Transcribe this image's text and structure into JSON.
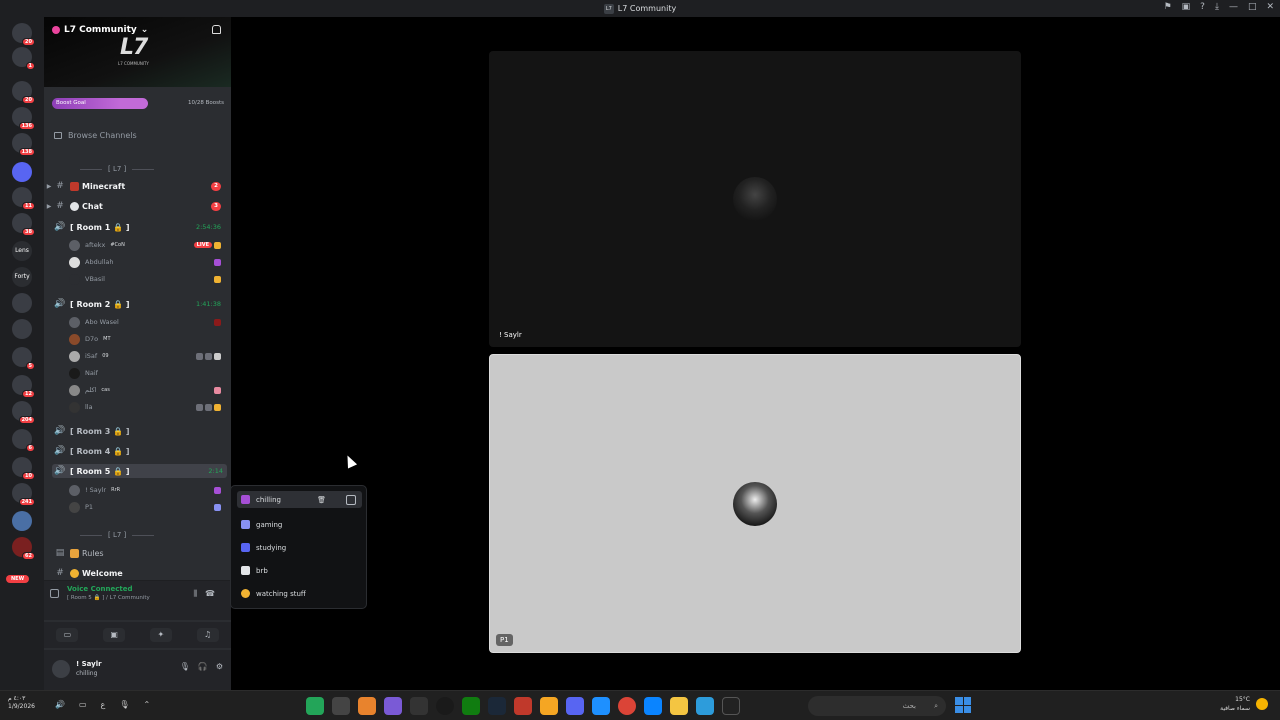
{
  "window": {
    "title": "L7 Community",
    "controls": [
      "⚑",
      "▣",
      "?",
      "⤓",
      "—",
      "□",
      "✕"
    ]
  },
  "guilds": {
    "badges": [
      "20",
      "1",
      "20",
      "136",
      "138",
      "11",
      "38",
      "5",
      "12",
      "204",
      "6",
      "10",
      "241",
      "62"
    ],
    "text_icons": [
      "Lens",
      "Forty"
    ],
    "new_label": "NEW"
  },
  "server": {
    "name": "L7 Community",
    "banner_text": "L7",
    "banner_sub": "L7 COMMUNITY",
    "boost_label": "Boost Goal",
    "boost_count": "10/28 Boosts",
    "boost_progress": 0.357,
    "browse_channels": "Browse Channels",
    "category_top": "[ L7 ]",
    "category_bottom": "[ L7 ]"
  },
  "channels": [
    {
      "name": "Minecraft",
      "mention": "2",
      "type": "text"
    },
    {
      "name": "Chat",
      "mention": "3",
      "type": "text"
    },
    {
      "name": "[ Room 1 🔒 ]",
      "time": "2:54:36",
      "type": "voice"
    },
    {
      "name": "[ Room 2 🔒 ]",
      "time": "1:41:38",
      "type": "voice"
    },
    {
      "name": "[ Room 3 🔒 ]",
      "type": "voice"
    },
    {
      "name": "[ Room 4 🔒 ]",
      "type": "voice"
    },
    {
      "name": "[ Room 5 🔒 ]",
      "time": "2:14",
      "type": "voice"
    },
    {
      "name": "Rules",
      "type": "text"
    },
    {
      "name": "Welcome",
      "type": "text"
    }
  ],
  "room1_users": [
    {
      "name": "aftekx",
      "tag": "#CoN",
      "live": "LIVE"
    },
    {
      "name": "Abdullah"
    },
    {
      "name": "VBasil"
    }
  ],
  "room2_users": [
    {
      "name": "Abo Wasel"
    },
    {
      "name": "D7o",
      "tag": "MT"
    },
    {
      "name": "iSaf",
      "tag": "09"
    },
    {
      "name": "Naif"
    },
    {
      "name": "اكلم",
      "tag": "cas"
    },
    {
      "name": "lla"
    }
  ],
  "room5_users": [
    {
      "name": "! Saylr",
      "tag": "RrR"
    },
    {
      "name": "P1"
    }
  ],
  "voice": {
    "status": "Voice Connected",
    "location": "[ Room 5 🔒 ] / L7 Community"
  },
  "user_panel": {
    "name": "! Saylr",
    "status": "chilling"
  },
  "status_menu": {
    "items": [
      {
        "label": "chilling",
        "color": "#a64fd6"
      },
      {
        "label": "gaming",
        "color": "#8891f2"
      },
      {
        "label": "studying",
        "color": "#5865f2"
      },
      {
        "label": "brb",
        "color": "#e3e5e8"
      },
      {
        "label": "watching stuff",
        "color": "#f0b232"
      }
    ]
  },
  "tiles": [
    {
      "label": "! Saylr"
    },
    {
      "label": "P1"
    }
  ],
  "taskbar": {
    "time": "٤:٠٣ م",
    "date": "1/9/2026",
    "search_placeholder": "بحث",
    "weather_temp": "15°C",
    "weather_desc": "سماء صافية"
  }
}
